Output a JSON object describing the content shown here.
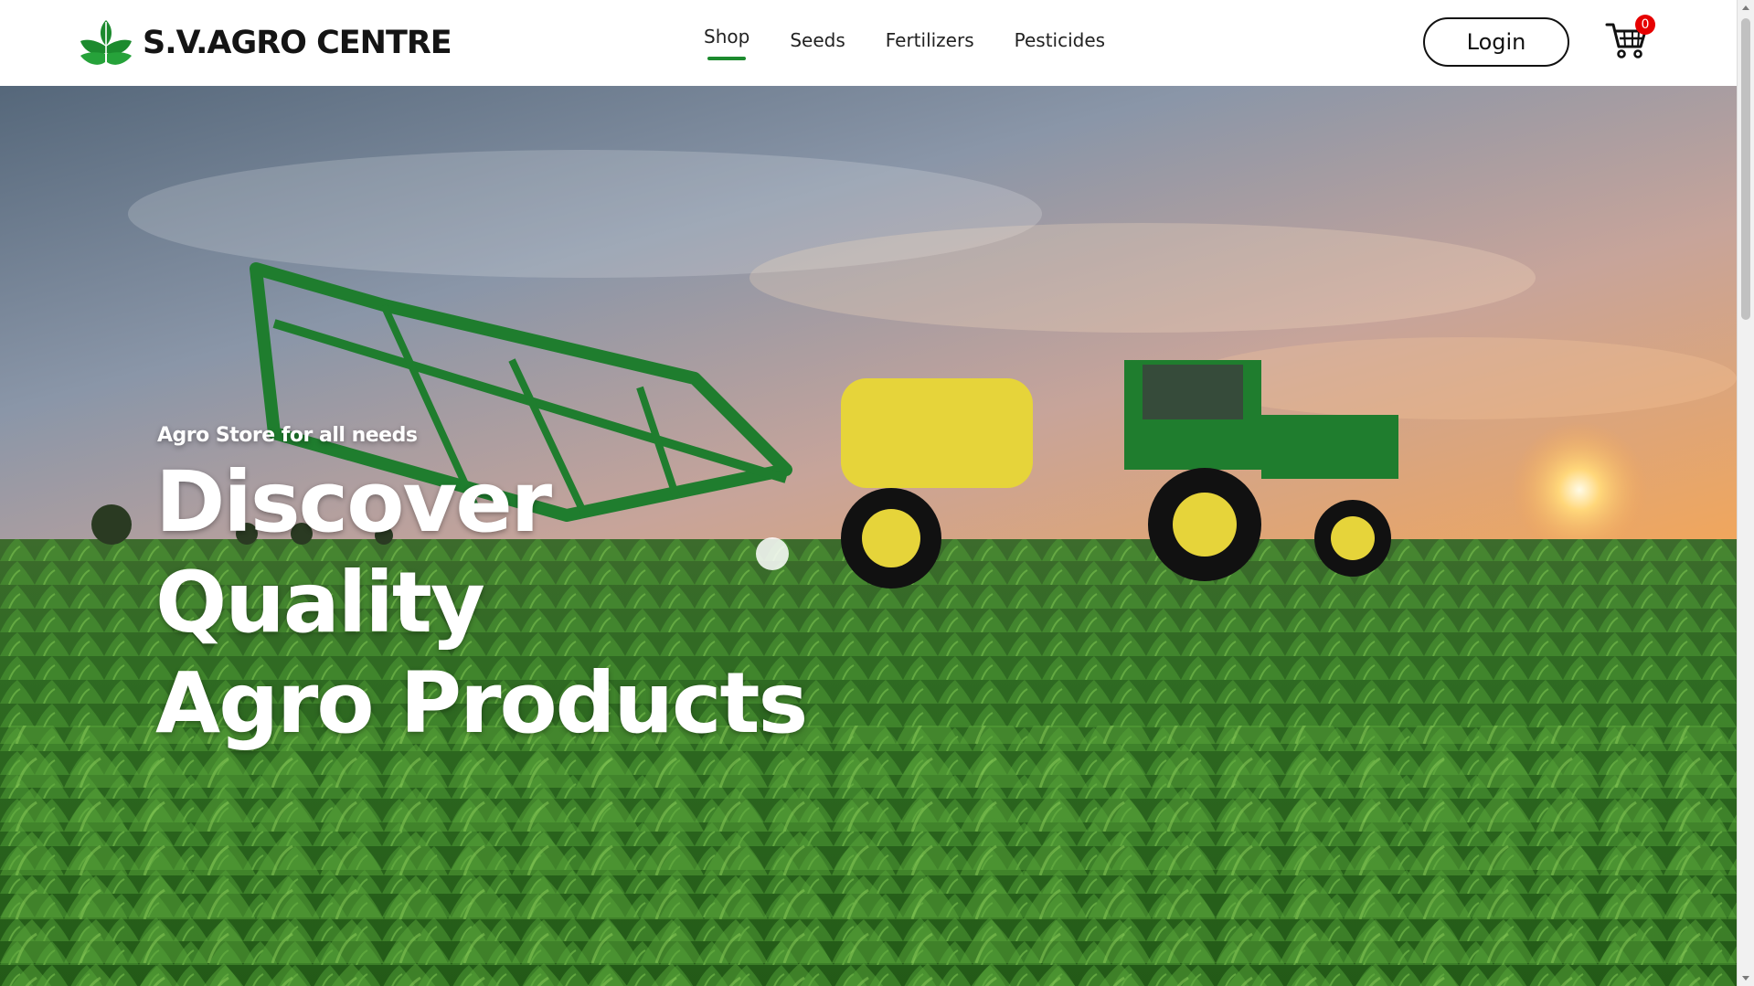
{
  "brand": {
    "name": "S.V.AGRO CENTRE",
    "logo_icon": "leaf-sprout-logo-icon",
    "accent_color": "#1c8a2e"
  },
  "nav": {
    "items": [
      {
        "label": "Shop",
        "active": true
      },
      {
        "label": "Seeds",
        "active": false
      },
      {
        "label": "Fertilizers",
        "active": false
      },
      {
        "label": "Pesticides",
        "active": false
      }
    ]
  },
  "header": {
    "login_label": "Login",
    "cart_icon": "shopping-cart-icon",
    "cart_count": "0",
    "badge_color": "#e60000"
  },
  "hero": {
    "kicker": "Agro Store for all needs",
    "headline_lines": [
      "Discover",
      "Quality",
      "Agro Products"
    ]
  }
}
